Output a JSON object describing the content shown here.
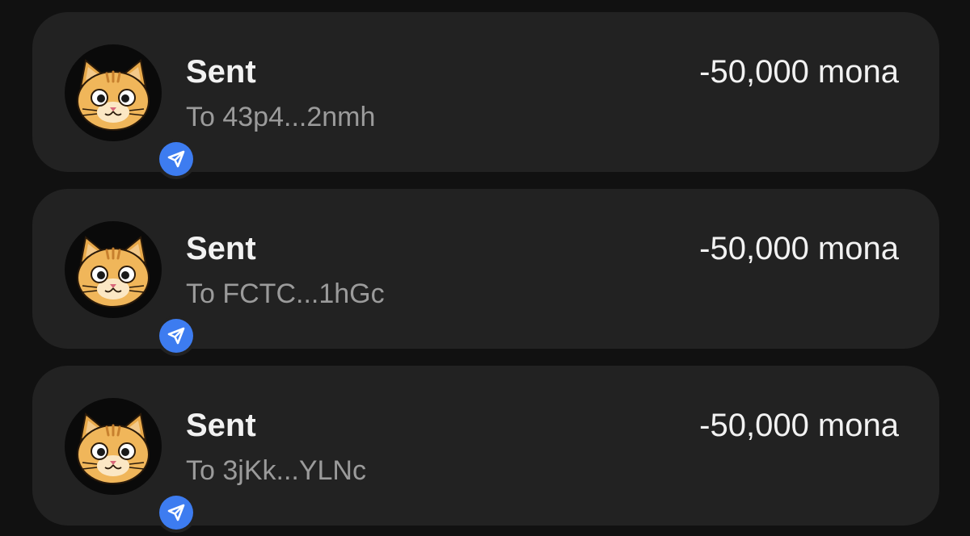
{
  "colors": {
    "background": "#111111",
    "card": "#222222",
    "badge": "#3d7cf0",
    "title": "#f2f2f2",
    "subtitle": "#9b9b9b"
  },
  "transactions": [
    {
      "title": "Sent",
      "recipient": "To 43p4...2nmh",
      "amount": "-50,000 mona",
      "avatar_icon": "cat-avatar-icon",
      "badge_icon": "send-arrow-icon"
    },
    {
      "title": "Sent",
      "recipient": "To FCTC...1hGc",
      "amount": "-50,000 mona",
      "avatar_icon": "cat-avatar-icon",
      "badge_icon": "send-arrow-icon"
    },
    {
      "title": "Sent",
      "recipient": "To 3jKk...YLNc",
      "amount": "-50,000 mona",
      "avatar_icon": "cat-avatar-icon",
      "badge_icon": "send-arrow-icon"
    }
  ]
}
